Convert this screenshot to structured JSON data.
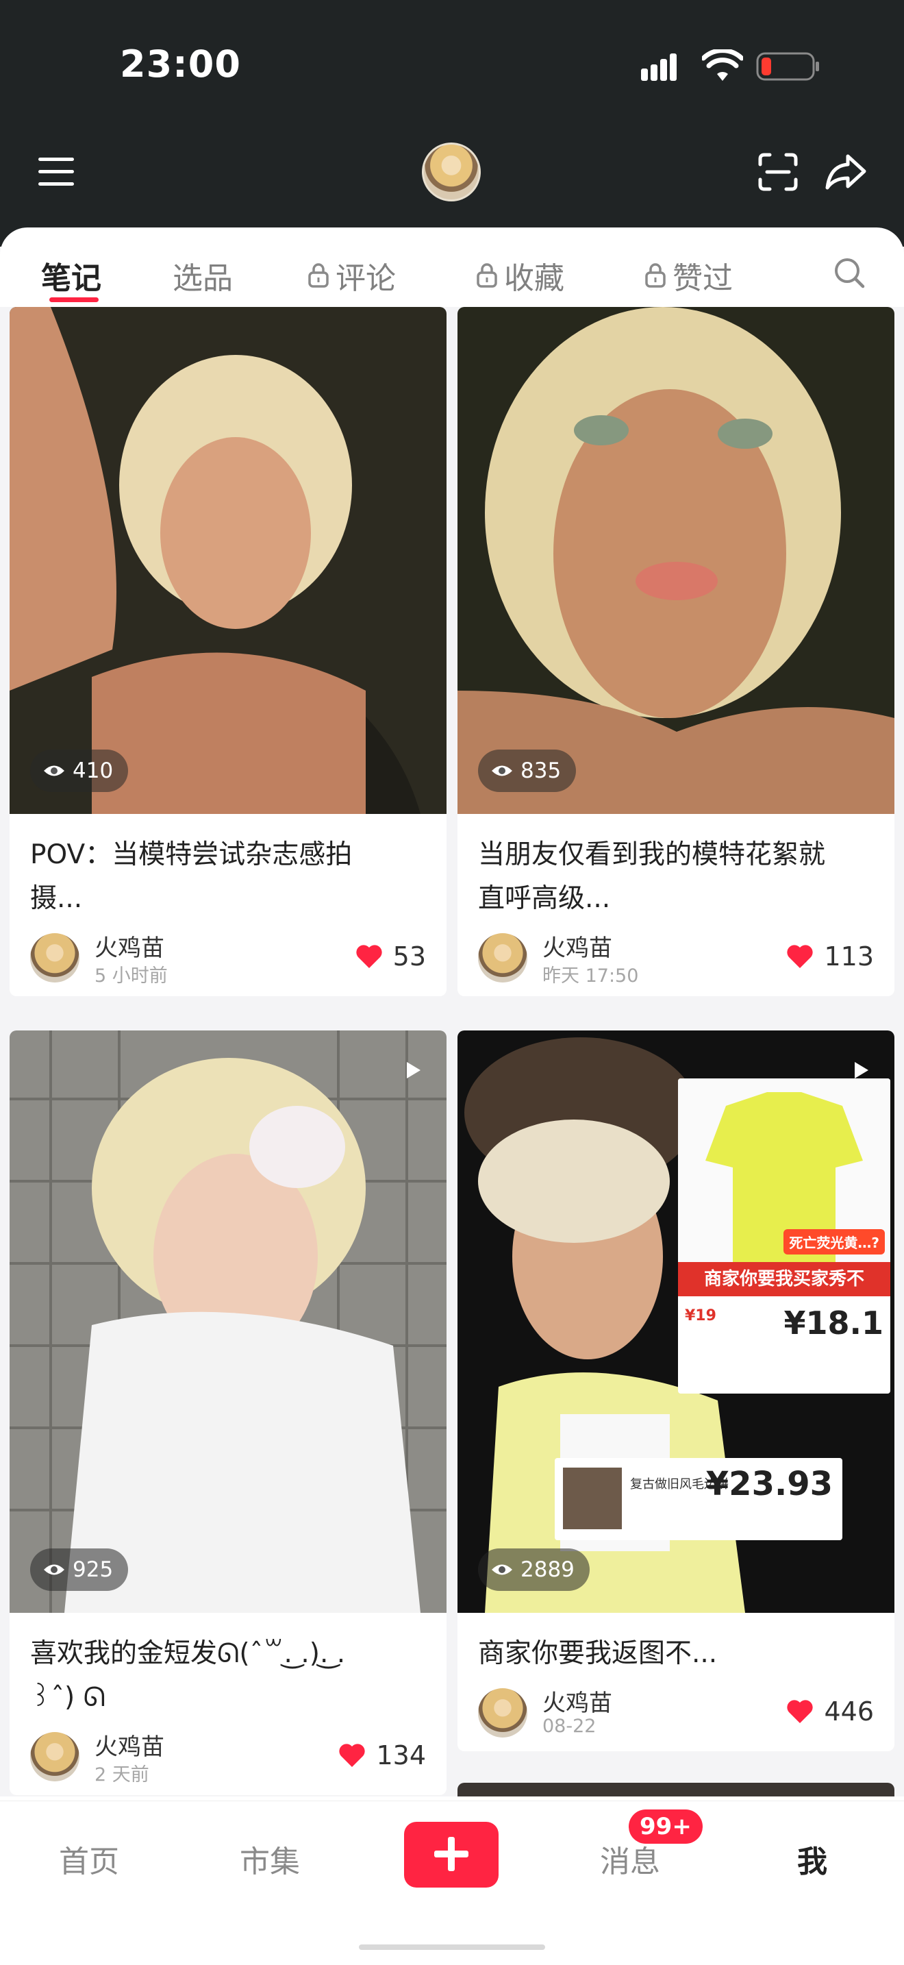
{
  "status_bar": {
    "time": "23:00"
  },
  "header": {
    "avatar_icon": "user-avatar"
  },
  "tabs": [
    {
      "label": "笔记",
      "locked": false
    },
    {
      "label": "选品",
      "locked": false
    },
    {
      "label": "评论",
      "locked": true
    },
    {
      "label": "收藏",
      "locked": true
    },
    {
      "label": "赞过",
      "locked": true
    }
  ],
  "cards": [
    {
      "views": "410",
      "title_line1": "POV：当模特尝试杂志感拍",
      "title_line2": "摄...",
      "author": "火鸡苗",
      "time": "5 小时前",
      "likes": "53",
      "video": false
    },
    {
      "views": "835",
      "title_line1": "当朋友仅看到我的模特花絮就",
      "title_line2": "直呼高级...",
      "author": "火鸡苗",
      "time": "昨天 17:50",
      "likes": "113",
      "video": false
    },
    {
      "views": "925",
      "title_line1": "喜欢我的金短发ᘏ(ˆ꒳.͜ .).͜ .",
      "title_line2": "꒱ˆ) ᘏ",
      "author": "火鸡苗",
      "time": "2 天前",
      "likes": "134",
      "video": true
    },
    {
      "views": "2889",
      "title_line1": "商家你要我返图不...",
      "author": "火鸡苗",
      "time": "08-22",
      "likes": "446",
      "video": true,
      "overlay_text": {
        "banner": "商家你要我买家秀不",
        "sticker": "死亡荧光黄…?",
        "price1": "¥18.1",
        "price2": "¥23.93",
        "tag": "¥19",
        "shop_line": "复古做旧风毛边拼"
      }
    }
  ],
  "bottom_nav": {
    "items": [
      {
        "label": "首页"
      },
      {
        "label": "市集"
      },
      {
        "label": "消息"
      },
      {
        "label": "我"
      }
    ],
    "message_badge": "99+"
  },
  "colors": {
    "accent": "#ff2442",
    "header_bg": "#202425"
  }
}
